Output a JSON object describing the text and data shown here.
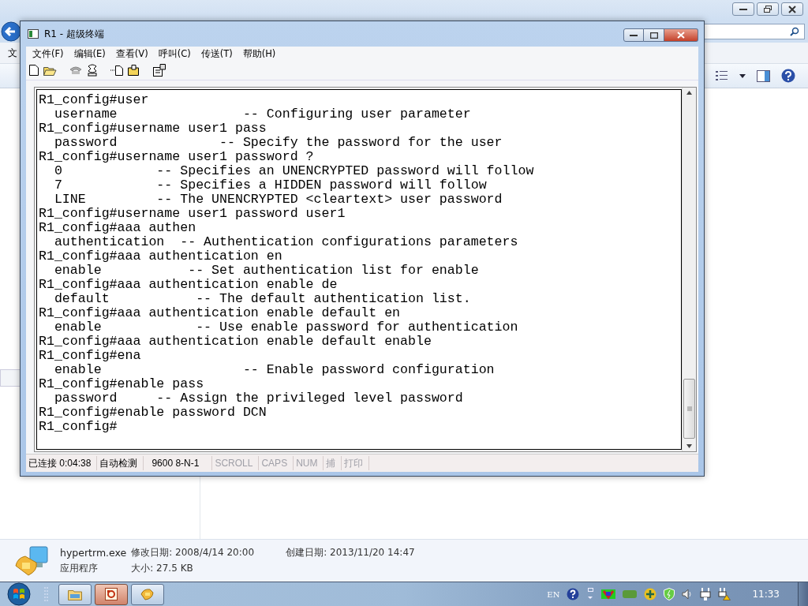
{
  "explorer": {
    "menu_partial": "文",
    "details": {
      "filename": "hypertrm.exe",
      "modified": "修改日期: 2008/4/14 20:00",
      "created": "创建日期: 2013/11/20 14:47",
      "type": "应用程序",
      "size": "大小: 27.5 KB"
    }
  },
  "terminal_window": {
    "title": "R1 - 超级终端",
    "menu": [
      "文件(F)",
      "编辑(E)",
      "查看(V)",
      "呼叫(C)",
      "传送(T)",
      "帮助(H)"
    ],
    "lines": [
      "R1_config#user",
      "  username                -- Configuring user parameter",
      "R1_config#username user1 pass",
      "  password             -- Specify the password for the user",
      "R1_config#username user1 password ?",
      "  0            -- Specifies an UNENCRYPTED password will follow",
      "  7            -- Specifies a HIDDEN password will follow",
      "  LINE         -- The UNENCRYPTED <cleartext> user password",
      "R1_config#username user1 password user1",
      "R1_config#aaa authen",
      "  authentication  -- Authentication configurations parameters",
      "R1_config#aaa authentication en",
      "  enable           -- Set authentication list for enable",
      "R1_config#aaa authentication enable de",
      "  default           -- The default authentication list.",
      "R1_config#aaa authentication enable default en",
      "  enable            -- Use enable password for authentication",
      "R1_config#aaa authentication enable default enable",
      "R1_config#ena",
      "  enable                  -- Enable password configuration",
      "R1_config#enable pass",
      "  password     -- Assign the privileged level password",
      "R1_config#enable password DCN",
      "R1_config#"
    ],
    "status": [
      {
        "text": "已连接 0:04:38",
        "active": true
      },
      {
        "text": "自动检测",
        "active": true
      },
      {
        "text": "9600 8-N-1",
        "active": true
      },
      {
        "text": "SCROLL",
        "active": false
      },
      {
        "text": "CAPS",
        "active": false
      },
      {
        "text": "NUM",
        "active": false
      },
      {
        "text": "捕",
        "active": false
      },
      {
        "text": "打印",
        "active": false
      }
    ]
  },
  "taskbar": {
    "buttons": [
      {
        "kind": "folder",
        "selected": false
      },
      {
        "kind": "media",
        "selected": true
      },
      {
        "kind": "phone",
        "selected": false
      }
    ],
    "language": "EN",
    "clock": "11:33"
  }
}
